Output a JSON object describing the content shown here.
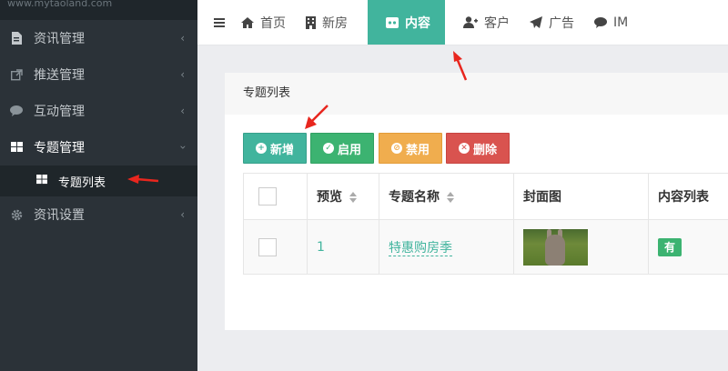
{
  "sidebar": {
    "top_text": "www.mytaoland.com",
    "items": [
      {
        "label": "资讯管理",
        "icon": "file-icon"
      },
      {
        "label": "推送管理",
        "icon": "external-link-icon"
      },
      {
        "label": "互动管理",
        "icon": "comment-icon"
      },
      {
        "label": "专题管理",
        "icon": "grid-icon"
      },
      {
        "label": "资讯设置",
        "icon": "gear-icon"
      }
    ],
    "sub_items": [
      {
        "label": "专题列表",
        "icon": "grid-icon"
      }
    ]
  },
  "topbar": {
    "tabs": [
      {
        "label": "首页",
        "icon": "home-icon"
      },
      {
        "label": "新房",
        "icon": "building-icon"
      },
      {
        "label": "内容",
        "icon": "content-icon"
      },
      {
        "label": "客户",
        "icon": "user-plus-icon"
      },
      {
        "label": "广告",
        "icon": "paper-plane-icon"
      },
      {
        "label": "IM",
        "icon": "chat-icon"
      }
    ]
  },
  "panel": {
    "title": "专题列表",
    "buttons": {
      "add": "新增",
      "enable": "启用",
      "disable": "禁用",
      "delete": "删除"
    },
    "table": {
      "headers": [
        "预览",
        "专题名称",
        "封面图",
        "内容列表"
      ],
      "rows": [
        {
          "preview": "1",
          "name": "特惠购房季",
          "has_content": "有"
        }
      ]
    }
  },
  "colors": {
    "accent": "#41b49d",
    "sidebar_bg": "#2b3238",
    "enable": "#3cb371",
    "disable": "#f0ad4e",
    "delete": "#d9534f",
    "annotation": "#e8261e"
  }
}
